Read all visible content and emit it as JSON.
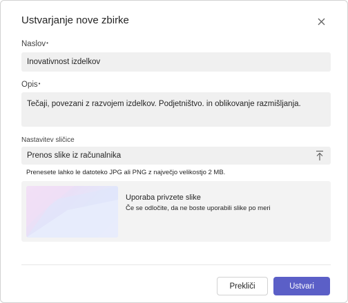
{
  "dialog": {
    "title": "Ustvarjanje nove zbirke",
    "close_icon": "close-icon"
  },
  "form": {
    "title_label": "Naslov",
    "title_value": "Inovativnost izdelkov",
    "desc_label": "Opis",
    "desc_value": "Tečaji, povezani z razvojem izdelkov. Podjetništvo. in oblikovanje razmišljanja.",
    "required_marker": "•",
    "thumbnail_label": "Nastavitev sličice",
    "upload_label": "Prenos slike iz računalnika",
    "upload_icon": "upload-icon",
    "upload_hint": "Prenesete lahko le datoteko JPG ali PNG z največjo velikostjo 2 MB.",
    "cover_title": "Uporaba privzete slike",
    "cover_desc": "Če se odločite, da ne boste uporabili slike po meri"
  },
  "footer": {
    "cancel_label": "Prekliči",
    "create_label": "Ustvari"
  },
  "colors": {
    "accent": "#5b5fc7",
    "field_bg": "#f0f0f0"
  }
}
